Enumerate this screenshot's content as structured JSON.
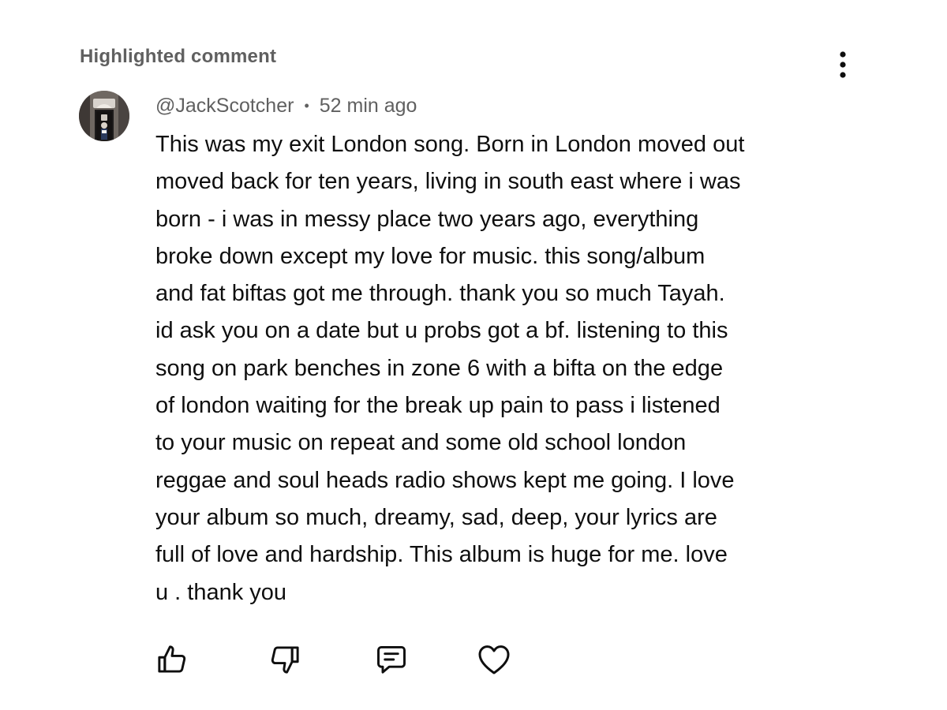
{
  "header": {
    "title": "Highlighted comment"
  },
  "comment": {
    "author": "@JackScotcher",
    "separator": "•",
    "time": "52 min ago",
    "lines": [
      "This was my exit London song. Born in London moved out",
      "moved back for ten years, living in south east where i was",
      "born - i was in messy place two years ago, everything",
      "broke down except my love for music. this song/album",
      "and fat biftas got me through. thank you so much Tayah.",
      "id ask you on a date but u probs got a bf. listening to this",
      "song on park benches in zone 6 with a bifta on the edge",
      "of london waiting for the break up pain to pass i listened",
      "to your music on repeat and some old school london",
      "reggae and soul heads radio shows kept me going. I love",
      "your album so much, dreamy, sad, deep, your lyrics are",
      "full of love and hardship. This album is huge for me. love",
      "u . thank you"
    ]
  },
  "actions": {
    "icons": [
      "thumbs-up-icon",
      "thumbs-down-icon",
      "reply-icon",
      "heart-icon"
    ]
  },
  "colors": {
    "text": "#0f0f0f",
    "secondary_text": "#606060",
    "background": "#ffffff"
  }
}
